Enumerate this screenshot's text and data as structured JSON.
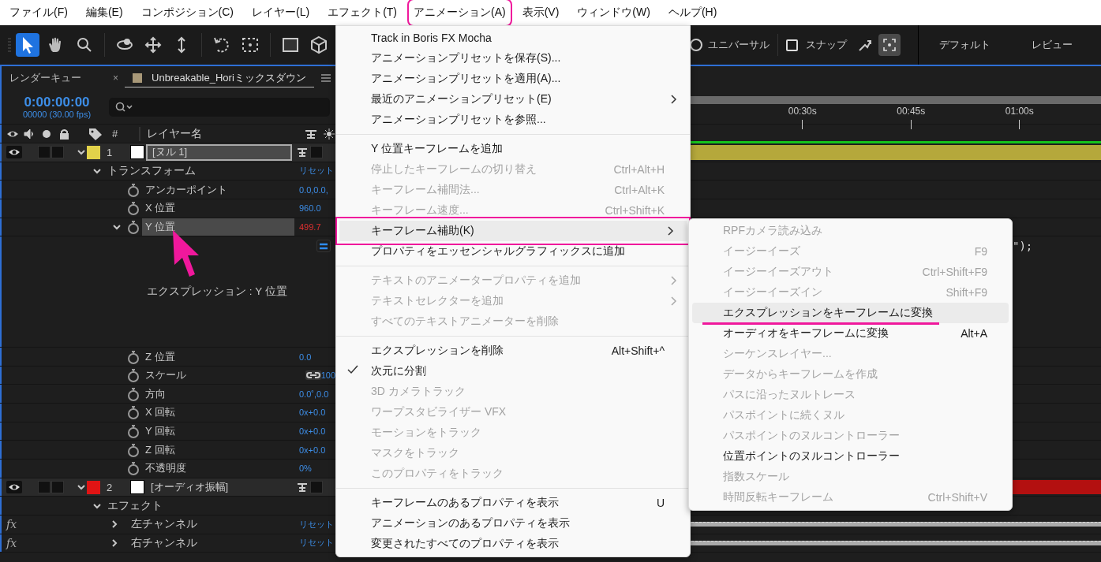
{
  "menu_bar": [
    {
      "label": "ファイル(F)",
      "selected": false
    },
    {
      "label": "編集(E)",
      "selected": false
    },
    {
      "label": "コンポジション(C)",
      "selected": false
    },
    {
      "label": "レイヤー(L)",
      "selected": false
    },
    {
      "label": "エフェクト(T)",
      "selected": false
    },
    {
      "label": "アニメーション(A)",
      "selected": true
    },
    {
      "label": "表示(V)",
      "selected": false
    },
    {
      "label": "ウィンドウ(W)",
      "selected": false
    },
    {
      "label": "ヘルプ(H)",
      "selected": false
    }
  ],
  "toolbar": {
    "axis_mode": {
      "label": "ユニバーサル",
      "selected": false
    },
    "snap": {
      "label": "スナップ",
      "checked": false
    },
    "workspaces": [
      "デフォルト",
      "レビュー"
    ]
  },
  "panel_tabs": [
    {
      "label": "レンダーキュー",
      "selected": false
    },
    {
      "label": "Unbreakable_Horiミックスダウン",
      "selected": true,
      "close": "×"
    }
  ],
  "timecode": "0:00:00:00",
  "frame_info": "00000 (30.00 fps)",
  "columns": {
    "number": "#",
    "layer_name": "レイヤー名"
  },
  "rows": [
    {
      "kind": "layer",
      "number": "1",
      "name": "[ヌル 1]",
      "color": "#e2d24a",
      "expanded": true,
      "selected": true,
      "solo": false,
      "locked": false
    },
    {
      "kind": "group",
      "label": "トランスフォーム",
      "value": "リセット",
      "expanded": true
    },
    {
      "kind": "property",
      "label": "アンカーポイント",
      "value": "0.0,0.0,",
      "expression": false,
      "selected": false
    },
    {
      "kind": "property",
      "label": "X 位置",
      "value": "960.0",
      "expression": false,
      "selected": false
    },
    {
      "kind": "property",
      "label": "Y 位置",
      "value": "499.7",
      "expression": true,
      "expanded": true,
      "selected": true
    },
    {
      "kind": "expression",
      "label": "エクスプレッション : Y 位置",
      "code_tail": "\");"
    },
    {
      "kind": "property",
      "label": "Z 位置",
      "value": "0.0",
      "expression": false,
      "selected": false
    },
    {
      "kind": "property",
      "label": "スケール",
      "value": "100",
      "linked": true,
      "expression": false,
      "selected": false
    },
    {
      "kind": "property",
      "label": "方向",
      "value": "0.0˚,0.0",
      "expression": false,
      "selected": false
    },
    {
      "kind": "property",
      "label": "X 回転",
      "value": "0x+0.0",
      "expression": false,
      "selected": false
    },
    {
      "kind": "property",
      "label": "Y 回転",
      "value": "0x+0.0",
      "expression": false,
      "selected": false
    },
    {
      "kind": "property",
      "label": "Z 回転",
      "value": "0x+0.0",
      "expression": false,
      "selected": false
    },
    {
      "kind": "property",
      "label": "不透明度",
      "value": "0%",
      "expression": false,
      "selected": false
    },
    {
      "kind": "layer",
      "number": "2",
      "name": "[オーディオ振幅]",
      "color": "#e01414",
      "expanded": true,
      "selected": false,
      "solo": false,
      "locked": false
    },
    {
      "kind": "group",
      "label": "エフェクト",
      "expanded": true
    },
    {
      "kind": "effect",
      "badge": "fx",
      "label": "左チャンネル",
      "value": "リセット",
      "expanded": false
    },
    {
      "kind": "effect",
      "badge": "fx",
      "label": "右チャンネル",
      "value": "リセット",
      "expanded": false
    }
  ],
  "timeline": {
    "ruler_labels": [
      "00:30s",
      "00:45s",
      "01:00s"
    ]
  },
  "menu": {
    "items": [
      {
        "label": "Track in Boris FX Mocha",
        "disabled": false
      },
      {
        "label": "アニメーションプリセットを保存(S)...",
        "disabled": false
      },
      {
        "label": "アニメーションプリセットを適用(A)...",
        "disabled": false
      },
      {
        "label": "最近のアニメーションプリセット(E)",
        "disabled": false,
        "submenu": true
      },
      {
        "label": "アニメーションプリセットを参照...",
        "disabled": false
      },
      {
        "kind": "separator"
      },
      {
        "label": "Y 位置キーフレームを追加",
        "disabled": false
      },
      {
        "label": "停止したキーフレームの切り替え",
        "shortcut": "Ctrl+Alt+H",
        "disabled": true
      },
      {
        "label": "キーフレーム補間法...",
        "shortcut": "Ctrl+Alt+K",
        "disabled": true
      },
      {
        "label": "キーフレーム速度...",
        "shortcut": "Ctrl+Shift+K",
        "disabled": true
      },
      {
        "label": "キーフレーム補助(K)",
        "disabled": false,
        "submenu": true,
        "highlighted": true,
        "annotated": true
      },
      {
        "label": "プロパティをエッセンシャルグラフィックスに追加",
        "disabled": false
      },
      {
        "kind": "separator"
      },
      {
        "label": "テキストのアニメータープロパティを追加",
        "disabled": true,
        "submenu": true
      },
      {
        "label": "テキストセレクターを追加",
        "disabled": true,
        "submenu": true
      },
      {
        "label": "すべてのテキストアニメーターを削除",
        "disabled": true
      },
      {
        "kind": "separator"
      },
      {
        "label": "エクスプレッションを削除",
        "shortcut": "Alt+Shift+^",
        "disabled": false
      },
      {
        "label": "次元に分割",
        "disabled": false,
        "checked": true
      },
      {
        "label": "3D カメラトラック",
        "disabled": true
      },
      {
        "label": "ワープスタビライザー VFX",
        "disabled": true
      },
      {
        "label": "モーションをトラック",
        "disabled": true
      },
      {
        "label": "マスクをトラック",
        "disabled": true
      },
      {
        "label": "このプロパティをトラック",
        "disabled": true
      },
      {
        "kind": "separator"
      },
      {
        "label": "キーフレームのあるプロパティを表示",
        "shortcut": "U",
        "disabled": false
      },
      {
        "label": "アニメーションのあるプロパティを表示",
        "disabled": false
      },
      {
        "label": "変更されたすべてのプロパティを表示",
        "disabled": false
      }
    ]
  },
  "submenu": {
    "items": [
      {
        "label": "RPFカメラ読み込み",
        "disabled": true
      },
      {
        "label": "イージーイーズ",
        "shortcut": "F9",
        "disabled": true
      },
      {
        "label": "イージーイーズアウト",
        "shortcut": "Ctrl+Shift+F9",
        "disabled": true
      },
      {
        "label": "イージーイーズイン",
        "shortcut": "Shift+F9",
        "disabled": true
      },
      {
        "label": "エクスプレッションをキーフレームに変換",
        "disabled": false,
        "highlighted": true,
        "underlined": true
      },
      {
        "label": "オーディオをキーフレームに変換",
        "shortcut": "Alt+A",
        "disabled": false
      },
      {
        "label": "シーケンスレイヤー...",
        "disabled": true
      },
      {
        "label": "データからキーフレームを作成",
        "disabled": true
      },
      {
        "label": "パスに沿ったヌルトレース",
        "disabled": true
      },
      {
        "label": "パスポイントに続くヌル",
        "disabled": true
      },
      {
        "label": "パスポイントのヌルコントローラー",
        "disabled": true
      },
      {
        "label": "位置ポイントのヌルコントローラー",
        "disabled": false
      },
      {
        "label": "指数スケール",
        "disabled": true
      },
      {
        "label": "時間反転キーフレーム",
        "shortcut": "Ctrl+Shift+V",
        "disabled": true
      }
    ]
  }
}
